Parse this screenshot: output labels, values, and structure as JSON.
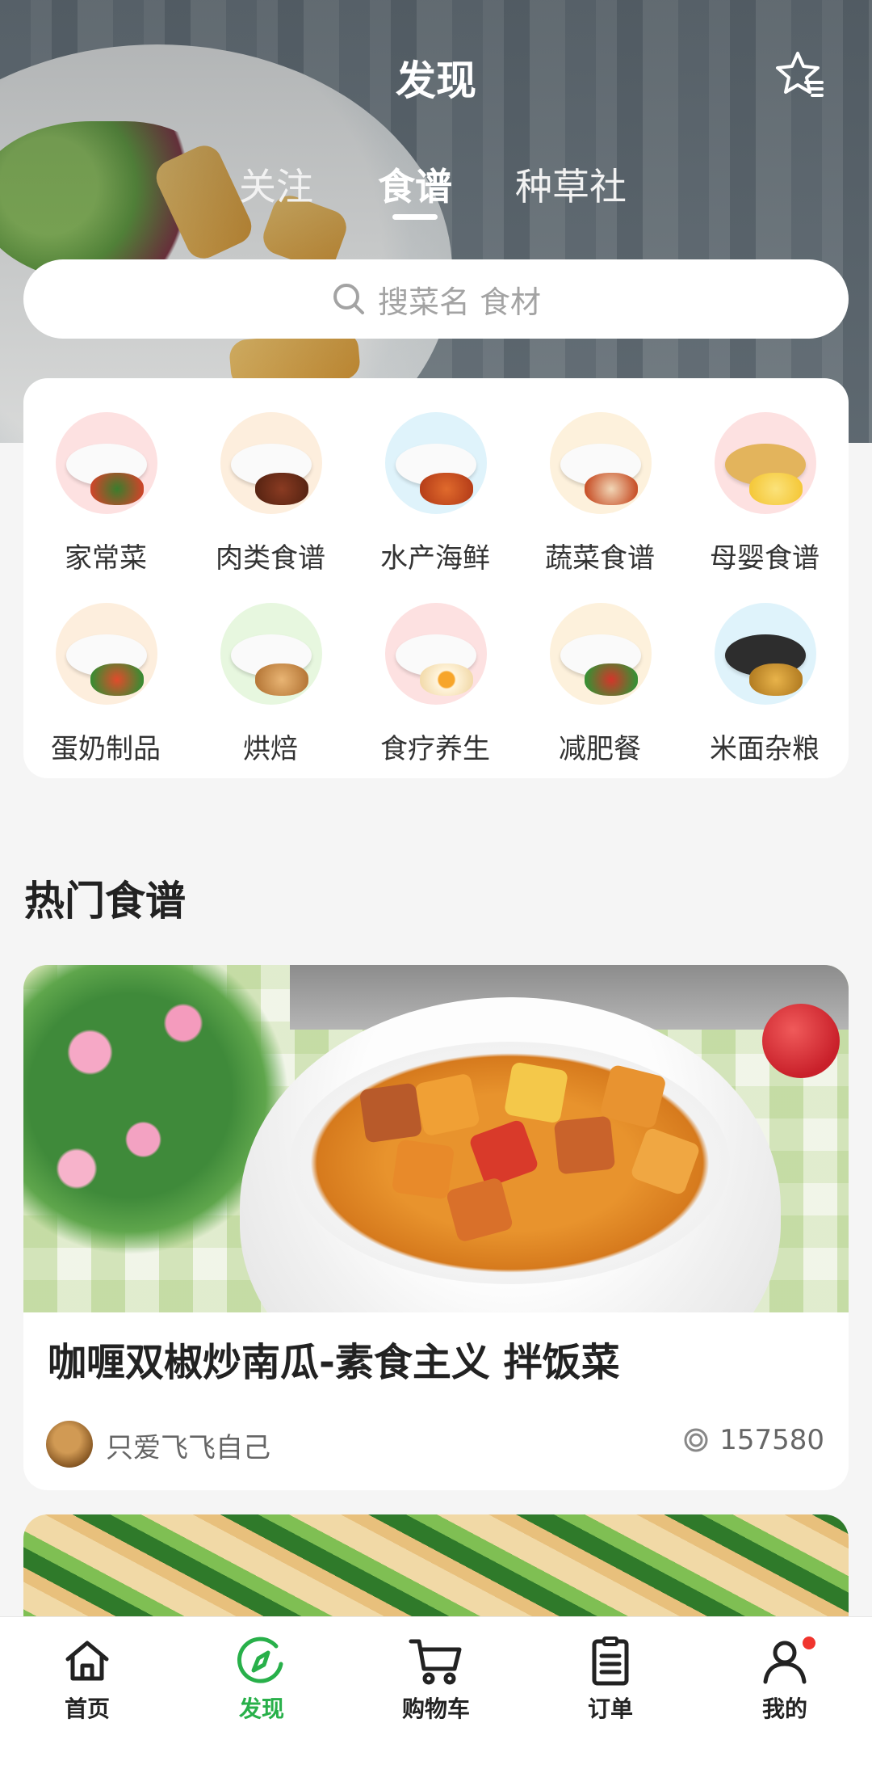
{
  "header": {
    "title": "发现",
    "star_icon": "star-list-icon"
  },
  "tabs": [
    {
      "label": "关注",
      "active": false
    },
    {
      "label": "食谱",
      "active": true
    },
    {
      "label": "种草社",
      "active": false
    }
  ],
  "search": {
    "placeholder": "搜菜名 食材",
    "icon": "search-icon"
  },
  "categories": [
    {
      "label": "家常菜",
      "color": "#fde1e1"
    },
    {
      "label": "肉类食谱",
      "color": "#fdeedd"
    },
    {
      "label": "水产海鲜",
      "color": "#dff3fb"
    },
    {
      "label": "蔬菜食谱",
      "color": "#fdf1dc"
    },
    {
      "label": "母婴食谱",
      "color": "#fde1e1"
    },
    {
      "label": "蛋奶制品",
      "color": "#fdeedd"
    },
    {
      "label": "烘焙",
      "color": "#e7f7df"
    },
    {
      "label": "食疗养生",
      "color": "#fde1e1"
    },
    {
      "label": "减肥餐",
      "color": "#fdf1dc"
    },
    {
      "label": "米面杂粮",
      "color": "#dff3fb"
    }
  ],
  "hot": {
    "section_title": "热门食谱",
    "cards": [
      {
        "title": "咖喱双椒炒南瓜-素食主义 拌饭菜",
        "author": "只爱飞飞自己",
        "views": "157580"
      }
    ]
  },
  "tabbar": {
    "items": [
      {
        "label": "首页",
        "icon": "home-icon",
        "active": false
      },
      {
        "label": "发现",
        "icon": "compass-icon",
        "active": true
      },
      {
        "label": "购物车",
        "icon": "cart-icon",
        "active": false
      },
      {
        "label": "订单",
        "icon": "clipboard-icon",
        "active": false
      },
      {
        "label": "我的",
        "icon": "user-icon",
        "active": false,
        "badge": true
      }
    ]
  },
  "colors": {
    "accent": "#28b04a",
    "badge": "#f0352e",
    "page_bg": "#f5f5f5"
  }
}
